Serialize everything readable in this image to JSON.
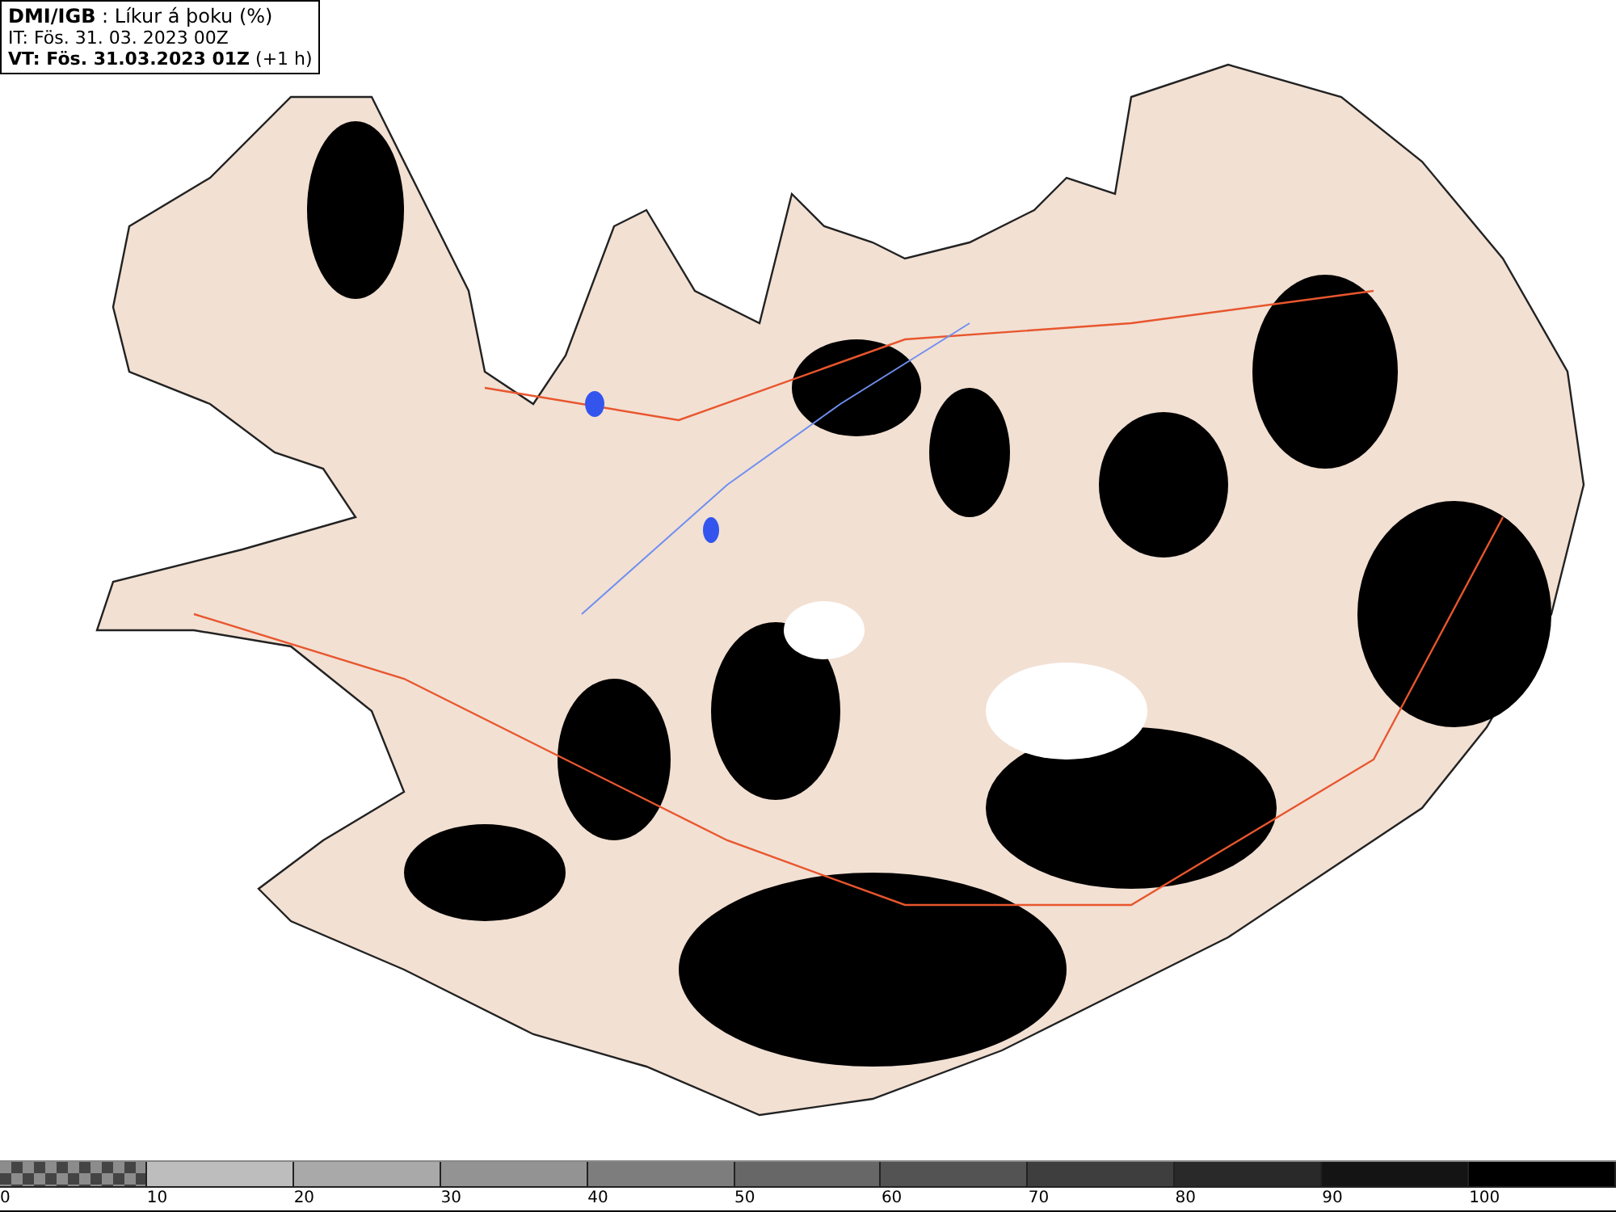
{
  "header": {
    "title": "**DMI/IGB** : Líkur á þoku (%)",
    "issue_time": "IT: Fös. 31. 03. 2023 00Z",
    "valid_time": "**VT: Fös. 31.03.2023 01Z** (+1 h)"
  },
  "legend": [
    {
      "label": "0",
      "kind": "checker"
    },
    {
      "label": "10",
      "kind": "solid",
      "color": "#bdbdbd"
    },
    {
      "label": "20",
      "kind": "solid",
      "color": "#a9a9a9"
    },
    {
      "label": "30",
      "kind": "solid",
      "color": "#939393"
    },
    {
      "label": "40",
      "kind": "solid",
      "color": "#7d7d7d"
    },
    {
      "label": "50",
      "kind": "solid",
      "color": "#676767"
    },
    {
      "label": "60",
      "kind": "solid",
      "color": "#535353"
    },
    {
      "label": "70",
      "kind": "solid",
      "color": "#3e3e3e"
    },
    {
      "label": "80",
      "kind": "solid",
      "color": "#292929"
    },
    {
      "label": "90",
      "kind": "solid",
      "color": "#141414"
    },
    {
      "label": "100",
      "kind": "solid",
      "color": "#000000"
    }
  ]
}
